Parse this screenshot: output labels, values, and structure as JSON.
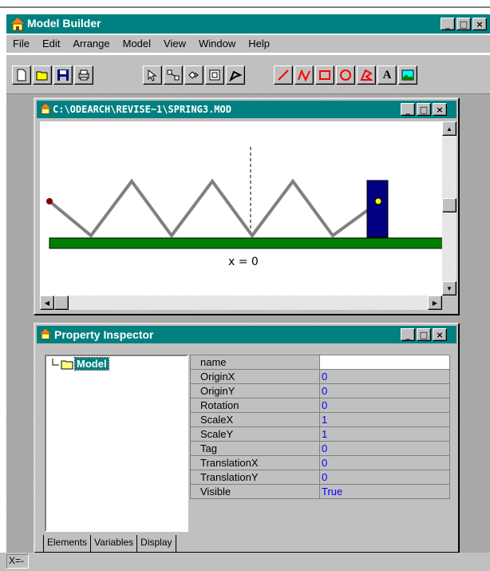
{
  "app": {
    "title": "Model Builder"
  },
  "menu": [
    "File",
    "Edit",
    "Arrange",
    "Model",
    "View",
    "Window",
    "Help"
  ],
  "toolbar": {
    "file_icons": [
      "new-file-icon",
      "open-folder-icon",
      "save-disk-icon",
      "print-icon"
    ],
    "tool_icons": [
      "arrow-pointer-icon",
      "resize-icon",
      "rotate-icon",
      "scale-icon",
      "bend-icon"
    ],
    "shape_icons": [
      "line-icon",
      "polyline-icon",
      "rectangle-icon",
      "ellipse-icon",
      "polygon-icon",
      "text-icon",
      "image-icon"
    ],
    "text_tool_label": "A"
  },
  "document": {
    "title": "C:\\ODEARCH\\REVISE~1\\SPRING3.MOD",
    "readout": "x = 0",
    "colors": {
      "floor": "#008000",
      "spring": "#808080",
      "block": "#000080",
      "anchor": "#800000",
      "pin": "#ffff00"
    }
  },
  "window_buttons": {
    "minimize": "_",
    "maximize": "□",
    "close": "×"
  },
  "property_inspector": {
    "title": "Property Inspector",
    "tree": {
      "root_label": "Model"
    },
    "properties": [
      {
        "key": "name",
        "value": ""
      },
      {
        "key": "OriginX",
        "value": "0"
      },
      {
        "key": "OriginY",
        "value": "0"
      },
      {
        "key": "Rotation",
        "value": "0"
      },
      {
        "key": "ScaleX",
        "value": "1"
      },
      {
        "key": "ScaleY",
        "value": "1"
      },
      {
        "key": "Tag",
        "value": "0"
      },
      {
        "key": "TranslationX",
        "value": "0"
      },
      {
        "key": "TranslationY",
        "value": "0"
      },
      {
        "key": "Visible",
        "value": "True"
      }
    ],
    "tabs": [
      "Elements",
      "Variables",
      "Display"
    ]
  },
  "status": {
    "coord_label": "X=-"
  }
}
